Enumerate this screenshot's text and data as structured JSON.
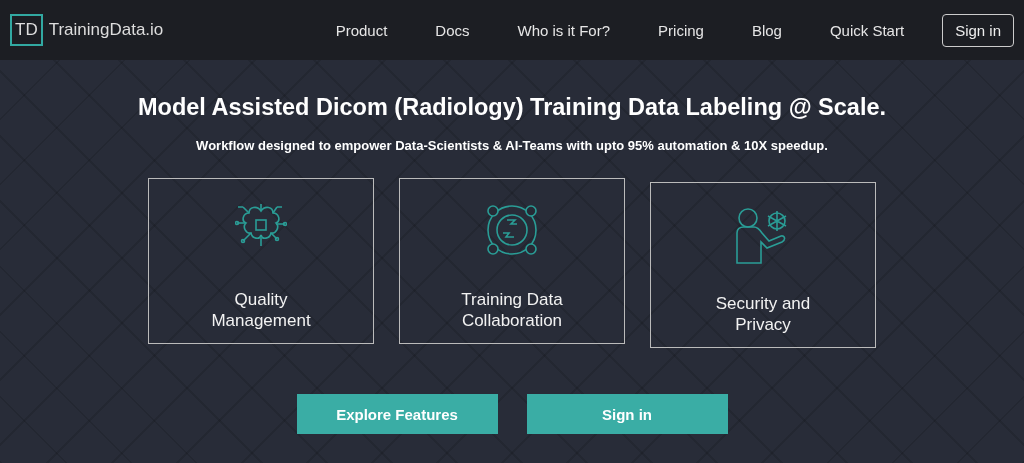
{
  "logo": {
    "mark": "TD",
    "name": "TrainingData.io"
  },
  "nav": [
    {
      "label": "Product"
    },
    {
      "label": "Docs"
    },
    {
      "label": "Who is it For?"
    },
    {
      "label": "Pricing"
    },
    {
      "label": "Blog"
    },
    {
      "label": "Quick Start"
    }
  ],
  "nav_button": "Sign in",
  "hero": {
    "title": "Model Assisted Dicom (Radiology) Training Data Labeling @ Scale.",
    "subtitle": "Workflow designed to empower Data-Scientists & AI-Teams with upto 95% automation & 10X speedup."
  },
  "features": [
    {
      "kind": "brain",
      "line1": "Quality",
      "line2": "Management"
    },
    {
      "kind": "globe",
      "line1": "Training Data",
      "line2": "Collaboration"
    },
    {
      "kind": "person",
      "line1": "Security and",
      "line2": "Privacy"
    }
  ],
  "buttons": [
    "Explore Features",
    "Sign in"
  ]
}
